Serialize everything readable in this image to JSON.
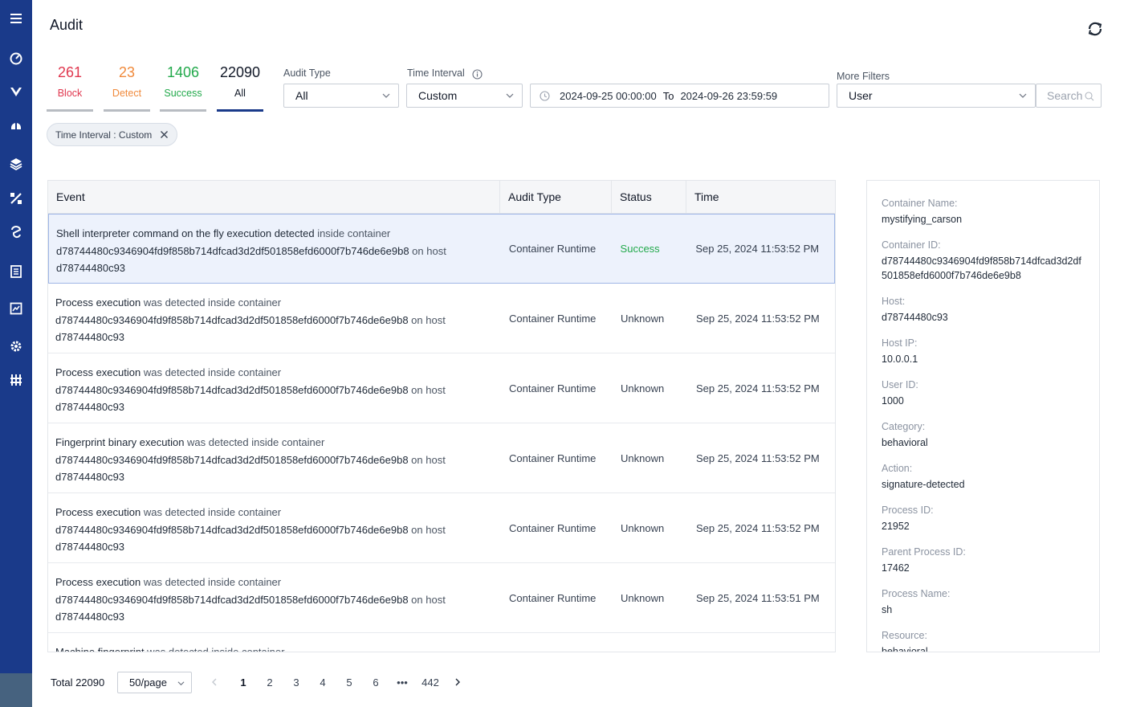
{
  "header": {
    "title": "Audit"
  },
  "stats": [
    {
      "value": "261",
      "label": "Block",
      "color": "#e0384f"
    },
    {
      "value": "23",
      "label": "Detect",
      "color": "#f08a3c"
    },
    {
      "value": "1406",
      "label": "Success",
      "color": "#22a94b"
    },
    {
      "value": "22090",
      "label": "All",
      "color": "#111827"
    }
  ],
  "filters": {
    "audit_type_label": "Audit Type",
    "audit_type_value": "All",
    "time_interval_label": "Time Interval",
    "time_interval_value": "Custom",
    "date_start": "2024-09-25 00:00:00",
    "date_to": "To",
    "date_end": "2024-09-26 23:59:59",
    "more_filters_label": "More Filters",
    "more_filters_value": "User",
    "search_placeholder": "Search"
  },
  "chip": {
    "label": "Time Interval : Custom"
  },
  "table": {
    "columns": [
      "Event",
      "Audit Type",
      "Status",
      "Time"
    ],
    "rows": [
      {
        "event_bold": "Shell interpreter command on the fly execution detected",
        "event_mid": " inside container",
        "event_id": "d78744480c9346904fd9f858b714dfcad3d2df501858efd6000f7b746de6e9b8",
        "event_host_word": " on host",
        "event_host": "d78744480c93",
        "audit_type": "Container Runtime",
        "status": "Success",
        "time": "Sep 25, 2024 11:53:52 PM"
      },
      {
        "event_bold": "Process execution",
        "event_mid": " was detected inside container",
        "event_id": "d78744480c9346904fd9f858b714dfcad3d2df501858efd6000f7b746de6e9b8",
        "event_host_word": " on host",
        "event_host": "d78744480c93",
        "audit_type": "Container Runtime",
        "status": "Unknown",
        "time": "Sep 25, 2024 11:53:52 PM"
      },
      {
        "event_bold": "Process execution",
        "event_mid": " was detected inside container",
        "event_id": "d78744480c9346904fd9f858b714dfcad3d2df501858efd6000f7b746de6e9b8",
        "event_host_word": " on host",
        "event_host": "d78744480c93",
        "audit_type": "Container Runtime",
        "status": "Unknown",
        "time": "Sep 25, 2024 11:53:52 PM"
      },
      {
        "event_bold": "Fingerprint binary execution",
        "event_mid": " was detected inside container",
        "event_id": "d78744480c9346904fd9f858b714dfcad3d2df501858efd6000f7b746de6e9b8",
        "event_host_word": " on host",
        "event_host": "d78744480c93",
        "audit_type": "Container Runtime",
        "status": "Unknown",
        "time": "Sep 25, 2024 11:53:52 PM"
      },
      {
        "event_bold": "Process execution",
        "event_mid": " was detected inside container",
        "event_id": "d78744480c9346904fd9f858b714dfcad3d2df501858efd6000f7b746de6e9b8",
        "event_host_word": " on host",
        "event_host": "d78744480c93",
        "audit_type": "Container Runtime",
        "status": "Unknown",
        "time": "Sep 25, 2024 11:53:52 PM"
      },
      {
        "event_bold": "Process execution",
        "event_mid": " was detected inside container",
        "event_id": "d78744480c9346904fd9f858b714dfcad3d2df501858efd6000f7b746de6e9b8",
        "event_host_word": " on host",
        "event_host": "d78744480c93",
        "audit_type": "Container Runtime",
        "status": "Unknown",
        "time": "Sep 25, 2024 11:53:51 PM"
      },
      {
        "event_bold": "Machine fingerprint",
        "event_mid": " was detected inside container",
        "event_id": "",
        "event_host_word": "",
        "event_host": "",
        "audit_type": "",
        "status": "",
        "time": ""
      }
    ]
  },
  "details": [
    {
      "key": "Container Name:",
      "value": "mystifying_carson"
    },
    {
      "key": "Container ID:",
      "value": "d78744480c9346904fd9f858b714dfcad3d2df501858efd6000f7b746de6e9b8"
    },
    {
      "key": "Host:",
      "value": "d78744480c93"
    },
    {
      "key": "Host IP:",
      "value": "10.0.0.1"
    },
    {
      "key": "User ID:",
      "value": "1000"
    },
    {
      "key": "Category:",
      "value": "behavioral"
    },
    {
      "key": "Action:",
      "value": "signature-detected"
    },
    {
      "key": "Process ID:",
      "value": "21952"
    },
    {
      "key": "Parent Process ID:",
      "value": "17462"
    },
    {
      "key": "Process Name:",
      "value": "sh"
    },
    {
      "key": "Resource:",
      "value": "behavioral"
    }
  ],
  "pagination": {
    "total": "Total 22090",
    "page_size": "50/page",
    "pages": [
      "1",
      "2",
      "3",
      "4",
      "5",
      "6",
      "•••",
      "442"
    ],
    "current": "1"
  },
  "colors": {
    "sidebar": "#1a3a8a",
    "accent": "#1a3a8a",
    "success": "#22a94b"
  }
}
